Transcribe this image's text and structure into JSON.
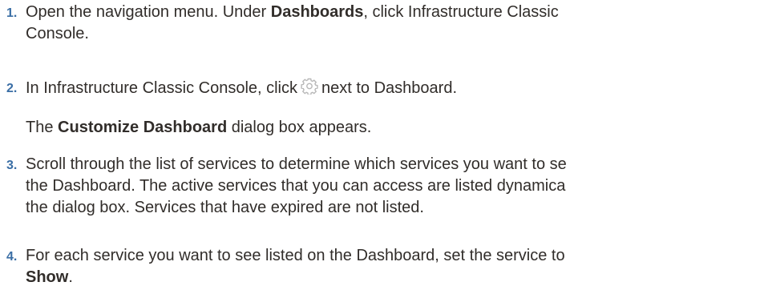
{
  "steps": [
    {
      "number": "1.",
      "before": "Open the navigation menu. Under ",
      "bold": "Dashboards",
      "after_line1": ", click Infrastructure Classic",
      "line2": "Console."
    },
    {
      "number": "2.",
      "before_icon": "In Infrastructure Classic Console, click",
      "icon": "gear-icon",
      "after_icon": "next to Dashboard.",
      "note_bold": "Customize Dashboard",
      "note_after": " dialog box appears.",
      "note_before": "The "
    },
    {
      "number": "3.",
      "line1": "Scroll through the list of services to determine which services you want to se",
      "line2": "the Dashboard. The active services that you can access are listed dynamica",
      "line3": "the dialog box. Services that have expired are not listed."
    },
    {
      "number": "4.",
      "line1": "For each service you want to see listed on the Dashboard, set the service to",
      "line2_bold": "Show",
      "line2_after": "."
    }
  ],
  "colors": {
    "step_number": "#3a6ea5",
    "text": "#312d2a",
    "icon": "#b8b8b8"
  }
}
